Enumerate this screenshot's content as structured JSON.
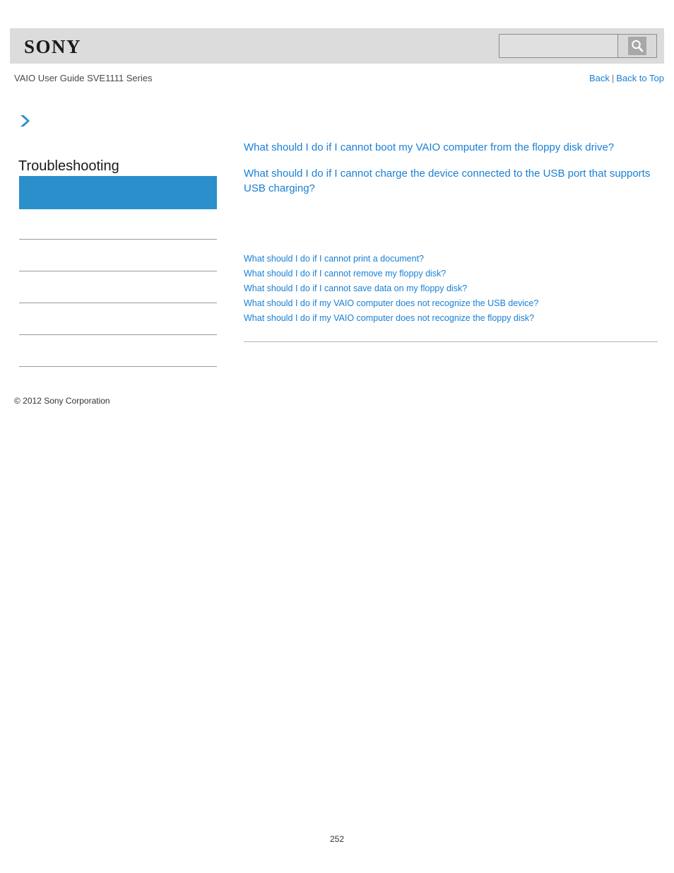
{
  "header": {
    "logo_text": "SONY",
    "search": {
      "value": "",
      "placeholder": "",
      "icon": "search-icon",
      "button_label": ""
    }
  },
  "subheader": {
    "guide_title": "VAIO User Guide SVE1111 Series",
    "back_label": "Back",
    "separator": "|",
    "back_to_top_label": "Back to Top"
  },
  "sidebar": {
    "chevron_icon": "chevron-right-icon",
    "section_title": "Troubleshooting",
    "active_item_label": "",
    "items": [
      {
        "label": ""
      },
      {
        "label": ""
      },
      {
        "label": ""
      },
      {
        "label": ""
      },
      {
        "label": ""
      }
    ]
  },
  "main": {
    "featured_links": [
      "What should I do if I cannot boot my VAIO computer from the floppy disk drive?",
      "What should I do if I cannot charge the device connected to the USB port that supports USB charging?"
    ],
    "list_links": [
      "What should I do if I cannot print a document?",
      "What should I do if I cannot remove my floppy disk?",
      "What should I do if I cannot save data on my floppy disk?",
      "What should I do if my VAIO computer does not recognize the USB device?",
      "What should I do if my VAIO computer does not recognize the floppy disk?"
    ]
  },
  "footer": {
    "copyright": "© 2012 Sony Corporation",
    "page_number": "252"
  },
  "colors": {
    "link_blue": "#1a7fd4",
    "accent_blue": "#2b8fcb",
    "header_gray": "#dcdcdc",
    "rule_gray": "#9a9a9a"
  }
}
